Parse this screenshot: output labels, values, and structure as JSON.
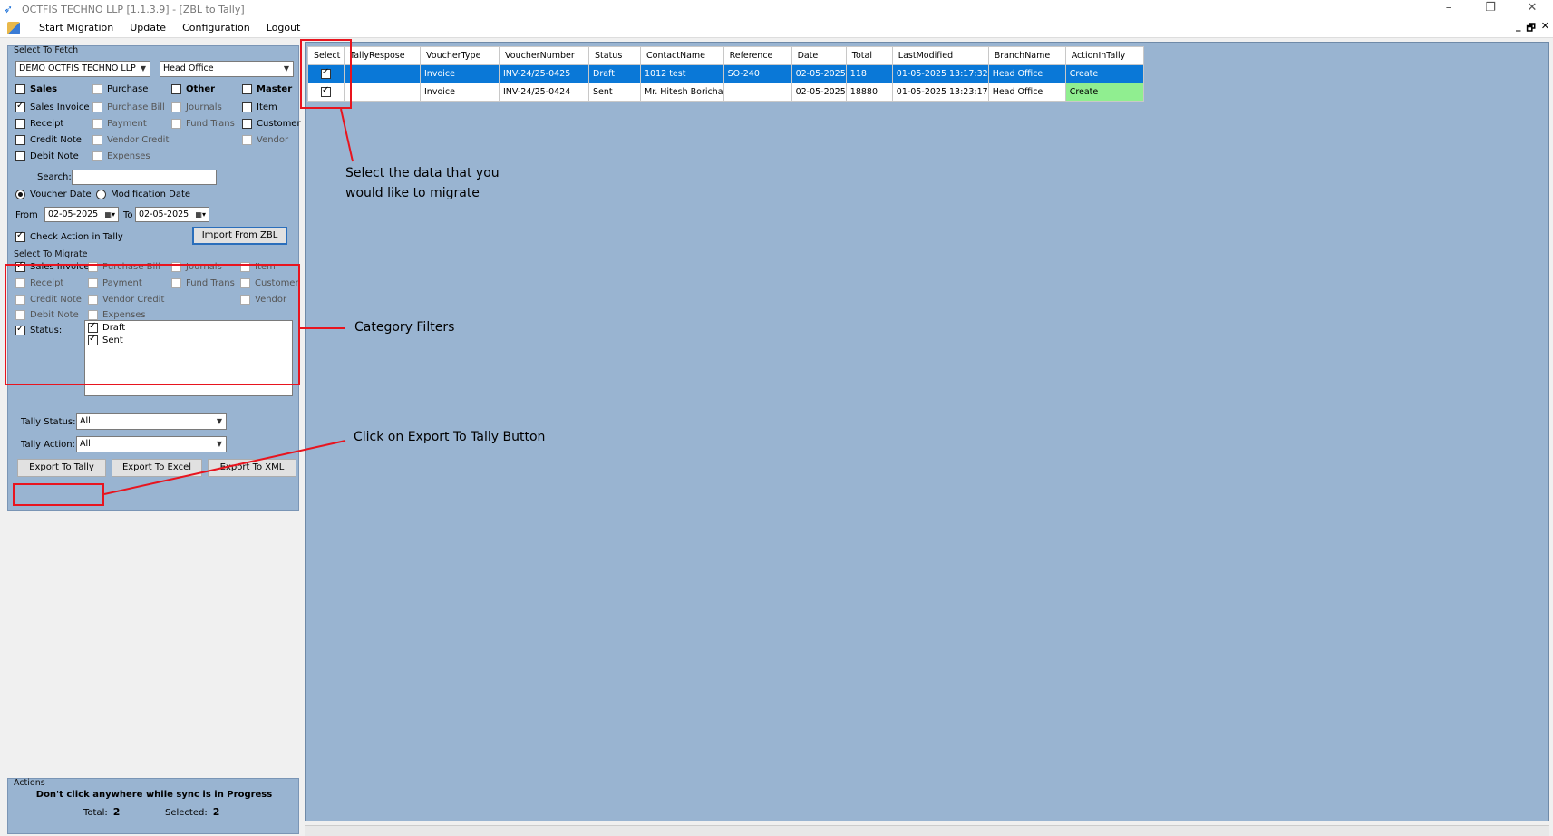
{
  "window": {
    "title": "OCTFIS TECHNO LLP [1.1.3.9] - [ZBL to Tally]",
    "controls": [
      "–",
      "❐",
      "✕"
    ],
    "mdi_controls": [
      "_",
      "🗗",
      "✕"
    ]
  },
  "menu": {
    "items": [
      "Start Migration",
      "Update",
      "Configuration",
      "Logout"
    ]
  },
  "fetch": {
    "title": "Select To Fetch",
    "company": "DEMO OCTFIS TECHNO LLP",
    "branch": "Head Office",
    "headers": [
      "Sales",
      "Purchase",
      "Other",
      "Master"
    ],
    "col1": [
      "Sales Invoice",
      "Receipt",
      "Credit Note",
      "Debit Note"
    ],
    "col2": [
      "Purchase Bill",
      "Payment",
      "Vendor Credit",
      "Expenses"
    ],
    "col3": [
      "Journals",
      "Fund Trans"
    ],
    "col4": [
      "Item",
      "Customer",
      "Vendor"
    ],
    "search_label": "Search:",
    "search_value": "",
    "radio_voucher": "Voucher Date",
    "radio_modification": "Modification Date",
    "from_label": "From",
    "from_date": "02-05-2025",
    "to_label": "To",
    "to_date": "02-05-2025",
    "check_action": "Check Action in Tally",
    "import_button": "Import From ZBL"
  },
  "migrate": {
    "title": "Select To Migrate",
    "col1": [
      "Sales Invoice",
      "Receipt",
      "Credit Note",
      "Debit Note"
    ],
    "col2": [
      "Purchase Bill",
      "Payment",
      "Vendor Credit",
      "Expenses"
    ],
    "col3": [
      "Journals",
      "Fund Trans"
    ],
    "col4": [
      "Item",
      "Customer",
      "Vendor"
    ],
    "status_label": "Status:",
    "status_options": [
      "Draft",
      "Sent"
    ],
    "tally_status_label": "Tally Status:",
    "tally_status_value": "All",
    "tally_action_label": "Tally Action:",
    "tally_action_value": "All",
    "export_tally": "Export To Tally",
    "export_excel": "Export To Excel",
    "export_xml": "Export To XML"
  },
  "actions": {
    "title": "Actions",
    "warning": "Don't click anywhere while sync is in Progress",
    "total_label": "Total:",
    "total_value": "2",
    "selected_label": "Selected:",
    "selected_value": "2"
  },
  "grid": {
    "columns": [
      "Select",
      "TallyRespose",
      "VoucherType",
      "VoucherNumber",
      "Status",
      "ContactName",
      "Reference",
      "Date",
      "Total",
      "LastModified",
      "BranchName",
      "ActionInTally"
    ],
    "rows": [
      [
        "",
        "",
        "Invoice",
        "INV-24/25-0425",
        "Draft",
        "1012 test",
        "SO-240",
        "02-05-2025",
        "118",
        "01-05-2025 13:17:32",
        "Head Office",
        "Create"
      ],
      [
        "",
        "",
        "Invoice",
        "INV-24/25-0424",
        "Sent",
        "Mr. Hitesh Boricha",
        "",
        "02-05-2025",
        "18880",
        "01-05-2025 13:23:17",
        "Head Office",
        "Create"
      ]
    ]
  },
  "annotations": {
    "select_data_1": "Select the data that you",
    "select_data_2": "would like to migrate",
    "category_filters": "Category Filters",
    "click_export": "Click on Export To Tally Button"
  },
  "colors": {
    "panel": "#99b4d1",
    "selected_row": "#0a78d7",
    "create_green": "#90ee90",
    "annotation_red": "#e8141e"
  }
}
